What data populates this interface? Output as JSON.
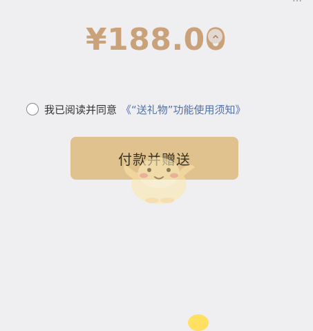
{
  "top_cut_text": "…",
  "price": {
    "amount": "¥188.00"
  },
  "agreement": {
    "label": "我已阅读并同意",
    "link": "《“送礼物”功能使用须知》"
  },
  "pay_button": {
    "label": "付款并赠送"
  },
  "icons": {
    "collapse": "chevron-up-icon",
    "mascot": "mascot-character-icon"
  },
  "colors": {
    "background": "#efeef1",
    "price": "#c9a27a",
    "button": "#dfc28e",
    "link": "#4f70a9"
  }
}
